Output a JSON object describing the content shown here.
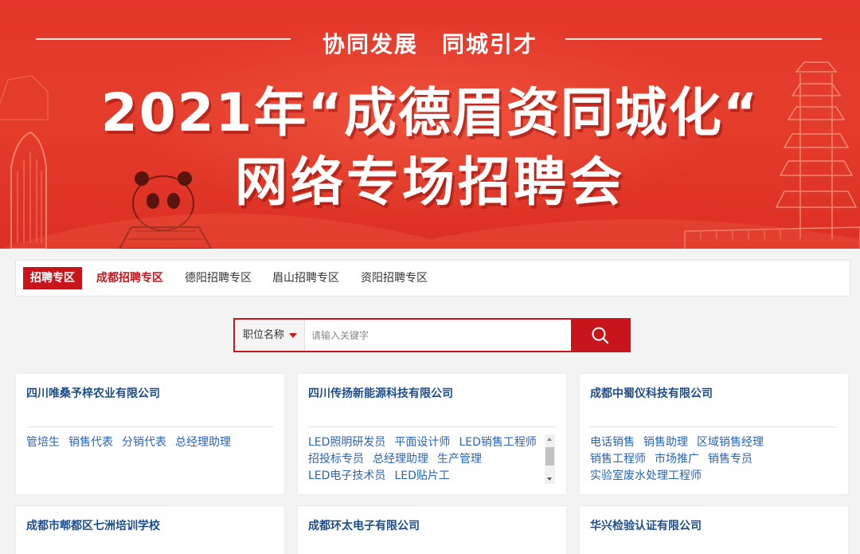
{
  "banner": {
    "slogan": "协同发展　同城引才",
    "title_line1": "2021年“成德眉资同城化“",
    "title_line2": "网络专场招聘会"
  },
  "tabs": {
    "header": "招聘专区",
    "items": [
      "成都招聘专区",
      "德阳招聘专区",
      "眉山招聘专区",
      "资阳招聘专区"
    ],
    "active_index": 0
  },
  "search": {
    "category": "职位名称",
    "placeholder": "请输入关键字",
    "button_icon": "search-icon"
  },
  "companies": [
    {
      "name": "四川唯桑予梓农业有限公司",
      "jobs": [
        "管培生",
        "销售代表",
        "分销代表",
        "总经理助理"
      ]
    },
    {
      "name": "四川传扬新能源科技有限公司",
      "jobs": [
        "LED照明研发员",
        "平面设计师",
        "LED销售工程师",
        "招投标专员",
        "总经理助理",
        "生产管理",
        "LED电子技术员",
        "LED贴片工"
      ]
    },
    {
      "name": "成都中蜀仪科技有限公司",
      "jobs": [
        "电话销售",
        "销售助理",
        "区域销售经理",
        "销售工程师",
        "市场推广",
        "销售专员",
        "实验室废水处理工程师"
      ]
    },
    {
      "name": "成都市郫都区七洲培训学校",
      "jobs": []
    },
    {
      "name": "成都环太电子有限公司",
      "jobs": []
    },
    {
      "name": "华兴检验认证有限公司",
      "jobs": []
    }
  ],
  "colors": {
    "brand_red": "#c8151c",
    "link_blue": "#2a64b4",
    "title_blue": "#1d4f8c"
  }
}
